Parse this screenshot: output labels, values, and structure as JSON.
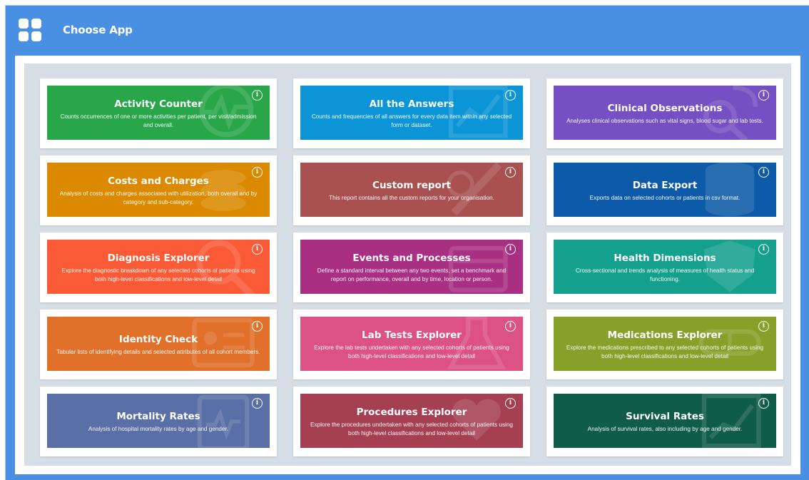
{
  "header": {
    "title": "Choose App"
  },
  "colors": {
    "header_bg": "#4a90e2",
    "panel_bg": "#d6dde4"
  },
  "apps": [
    {
      "title": "Activity Counter",
      "desc": "Counts occurrences of one or more activities per patient, per visit/admission and overall.",
      "color": "#2aa64a",
      "icon": "heartbeat-icon"
    },
    {
      "title": "All the Answers",
      "desc": "Counts and frequencies of all answers for every data item within any selected form or dataset.",
      "color": "#0b94d6",
      "icon": "chart-icon"
    },
    {
      "title": "Clinical Observations",
      "desc": "Analyses clinical observations such as vital signs, blood sugar and lab tests.",
      "color": "#7550c2",
      "icon": "stethoscope-icon"
    },
    {
      "title": "Costs and Charges",
      "desc": "Analysis of costs and charges associated with utilization, both overall and by category and sub-category.",
      "color": "#db8a00",
      "icon": "coins-icon"
    },
    {
      "title": "Custom report",
      "desc": "This report contains all the custom reports for your organisation.",
      "color": "#a85150",
      "icon": "pen-icon"
    },
    {
      "title": "Data Export",
      "desc": "Exports data on selected cohorts or patients in csv format.",
      "color": "#0c5aa8",
      "icon": "database-icon"
    },
    {
      "title": "Diagnosis Explorer",
      "desc": "Explore the diagnostic breakdown of any selected cohorts of patients using both high-level classifications and low-level detail",
      "color": "#fb5a36",
      "icon": "magnifier-icon"
    },
    {
      "title": "Events and Processes",
      "desc": "Define a standard interval between any two events, set a benchmark and report on performance, overall and by time, location or person.",
      "color": "#a92f82",
      "icon": "calendar-icon"
    },
    {
      "title": "Health Dimensions",
      "desc": "Cross-sectional and trends analysis of measures of health status and functioning.",
      "color": "#14a08d",
      "icon": "shield-icon"
    },
    {
      "title": "Identity Check",
      "desc": "Tabular lists of identifying details and selected attributes of all cohort members.",
      "color": "#e0702a",
      "icon": "id-card-icon"
    },
    {
      "title": "Lab Tests Explorer",
      "desc": "Explore the lab tests undertaken with any selected cohorts of patients using both high-level classifications and low-level detail",
      "color": "#dc5282",
      "icon": "flask-icon"
    },
    {
      "title": "Medications Explorer",
      "desc": "Explore the medications prescribed to any selected cohorts of patients using both high-level classifications and low-level detail",
      "color": "#86a02a",
      "icon": "pill-icon"
    },
    {
      "title": "Mortality Rates",
      "desc": "Analysis of hospital mortality rates by age and gender.",
      "color": "#5a6fa6",
      "icon": "clipboard-icon"
    },
    {
      "title": "Procedures Explorer",
      "desc": "Explore the procedures undertaken with any selected cohorts of patients using both high-level classifications and low-level detail",
      "color": "#a53f52",
      "icon": "heart-search-icon"
    },
    {
      "title": "Survival Rates",
      "desc": "Analysis of survival rates, also including by age and gender.",
      "color": "#0f5c48",
      "icon": "trend-icon"
    }
  ]
}
